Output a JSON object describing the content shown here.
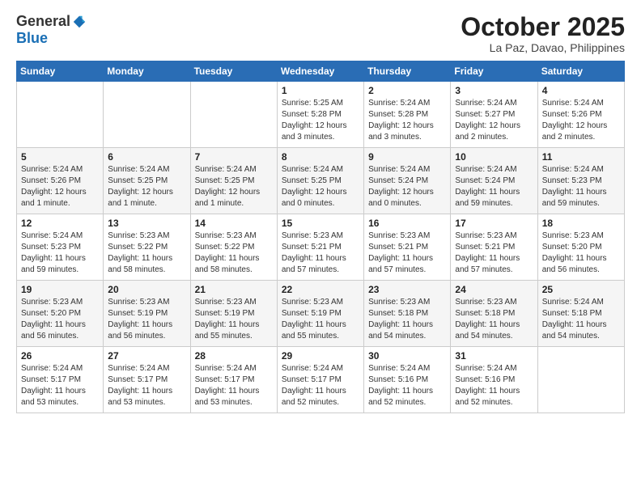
{
  "logo": {
    "general": "General",
    "blue": "Blue"
  },
  "title": "October 2025",
  "location": "La Paz, Davao, Philippines",
  "days": [
    "Sunday",
    "Monday",
    "Tuesday",
    "Wednesday",
    "Thursday",
    "Friday",
    "Saturday"
  ],
  "weeks": [
    [
      {
        "date": "",
        "info": ""
      },
      {
        "date": "",
        "info": ""
      },
      {
        "date": "",
        "info": ""
      },
      {
        "date": "1",
        "info": "Sunrise: 5:25 AM\nSunset: 5:28 PM\nDaylight: 12 hours\nand 3 minutes."
      },
      {
        "date": "2",
        "info": "Sunrise: 5:24 AM\nSunset: 5:28 PM\nDaylight: 12 hours\nand 3 minutes."
      },
      {
        "date": "3",
        "info": "Sunrise: 5:24 AM\nSunset: 5:27 PM\nDaylight: 12 hours\nand 2 minutes."
      },
      {
        "date": "4",
        "info": "Sunrise: 5:24 AM\nSunset: 5:26 PM\nDaylight: 12 hours\nand 2 minutes."
      }
    ],
    [
      {
        "date": "5",
        "info": "Sunrise: 5:24 AM\nSunset: 5:26 PM\nDaylight: 12 hours\nand 1 minute."
      },
      {
        "date": "6",
        "info": "Sunrise: 5:24 AM\nSunset: 5:25 PM\nDaylight: 12 hours\nand 1 minute."
      },
      {
        "date": "7",
        "info": "Sunrise: 5:24 AM\nSunset: 5:25 PM\nDaylight: 12 hours\nand 1 minute."
      },
      {
        "date": "8",
        "info": "Sunrise: 5:24 AM\nSunset: 5:25 PM\nDaylight: 12 hours\nand 0 minutes."
      },
      {
        "date": "9",
        "info": "Sunrise: 5:24 AM\nSunset: 5:24 PM\nDaylight: 12 hours\nand 0 minutes."
      },
      {
        "date": "10",
        "info": "Sunrise: 5:24 AM\nSunset: 5:24 PM\nDaylight: 11 hours\nand 59 minutes."
      },
      {
        "date": "11",
        "info": "Sunrise: 5:24 AM\nSunset: 5:23 PM\nDaylight: 11 hours\nand 59 minutes."
      }
    ],
    [
      {
        "date": "12",
        "info": "Sunrise: 5:24 AM\nSunset: 5:23 PM\nDaylight: 11 hours\nand 59 minutes."
      },
      {
        "date": "13",
        "info": "Sunrise: 5:23 AM\nSunset: 5:22 PM\nDaylight: 11 hours\nand 58 minutes."
      },
      {
        "date": "14",
        "info": "Sunrise: 5:23 AM\nSunset: 5:22 PM\nDaylight: 11 hours\nand 58 minutes."
      },
      {
        "date": "15",
        "info": "Sunrise: 5:23 AM\nSunset: 5:21 PM\nDaylight: 11 hours\nand 57 minutes."
      },
      {
        "date": "16",
        "info": "Sunrise: 5:23 AM\nSunset: 5:21 PM\nDaylight: 11 hours\nand 57 minutes."
      },
      {
        "date": "17",
        "info": "Sunrise: 5:23 AM\nSunset: 5:21 PM\nDaylight: 11 hours\nand 57 minutes."
      },
      {
        "date": "18",
        "info": "Sunrise: 5:23 AM\nSunset: 5:20 PM\nDaylight: 11 hours\nand 56 minutes."
      }
    ],
    [
      {
        "date": "19",
        "info": "Sunrise: 5:23 AM\nSunset: 5:20 PM\nDaylight: 11 hours\nand 56 minutes."
      },
      {
        "date": "20",
        "info": "Sunrise: 5:23 AM\nSunset: 5:19 PM\nDaylight: 11 hours\nand 56 minutes."
      },
      {
        "date": "21",
        "info": "Sunrise: 5:23 AM\nSunset: 5:19 PM\nDaylight: 11 hours\nand 55 minutes."
      },
      {
        "date": "22",
        "info": "Sunrise: 5:23 AM\nSunset: 5:19 PM\nDaylight: 11 hours\nand 55 minutes."
      },
      {
        "date": "23",
        "info": "Sunrise: 5:23 AM\nSunset: 5:18 PM\nDaylight: 11 hours\nand 54 minutes."
      },
      {
        "date": "24",
        "info": "Sunrise: 5:23 AM\nSunset: 5:18 PM\nDaylight: 11 hours\nand 54 minutes."
      },
      {
        "date": "25",
        "info": "Sunrise: 5:24 AM\nSunset: 5:18 PM\nDaylight: 11 hours\nand 54 minutes."
      }
    ],
    [
      {
        "date": "26",
        "info": "Sunrise: 5:24 AM\nSunset: 5:17 PM\nDaylight: 11 hours\nand 53 minutes."
      },
      {
        "date": "27",
        "info": "Sunrise: 5:24 AM\nSunset: 5:17 PM\nDaylight: 11 hours\nand 53 minutes."
      },
      {
        "date": "28",
        "info": "Sunrise: 5:24 AM\nSunset: 5:17 PM\nDaylight: 11 hours\nand 53 minutes."
      },
      {
        "date": "29",
        "info": "Sunrise: 5:24 AM\nSunset: 5:17 PM\nDaylight: 11 hours\nand 52 minutes."
      },
      {
        "date": "30",
        "info": "Sunrise: 5:24 AM\nSunset: 5:16 PM\nDaylight: 11 hours\nand 52 minutes."
      },
      {
        "date": "31",
        "info": "Sunrise: 5:24 AM\nSunset: 5:16 PM\nDaylight: 11 hours\nand 52 minutes."
      },
      {
        "date": "",
        "info": ""
      }
    ]
  ]
}
